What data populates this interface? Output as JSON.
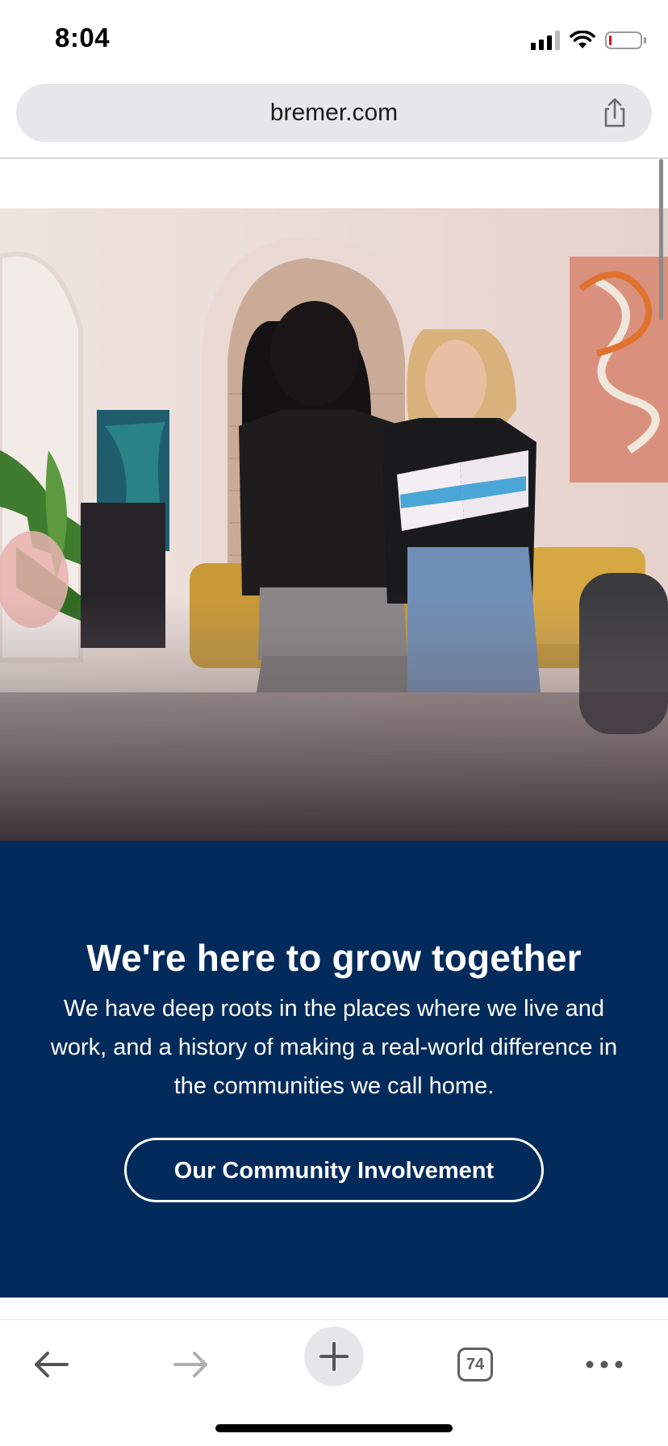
{
  "status_bar": {
    "time": "8:04"
  },
  "browser": {
    "url": "bremer.com",
    "tab_count": "74"
  },
  "promo": {
    "title": "We're here to grow together",
    "body": "We have deep roots in the places where we live and work, and a history of making a real-world difference in the communities we call home.",
    "button_label": "Our Community Involvement"
  },
  "colors": {
    "promo_background": "#022b5c",
    "promo_text": "#ffffff"
  },
  "icons": {
    "share": "share-icon",
    "back": "back-arrow-icon",
    "forward": "forward-arrow-icon",
    "new_tab": "plus-icon",
    "tabs": "tabs-icon",
    "more": "more-dots-icon"
  }
}
